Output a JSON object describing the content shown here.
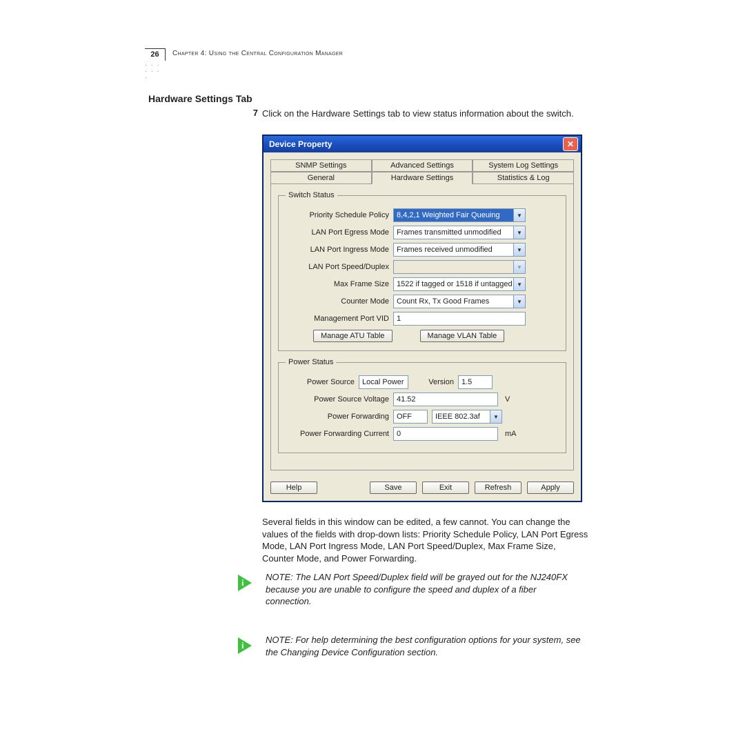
{
  "header": {
    "page_number": "26",
    "chapter_line": "Chapter 4: Using the Central Configuration Manager"
  },
  "section_title": "Hardware Settings Tab",
  "step": {
    "num": "7",
    "text": "Click on the Hardware Settings tab to view status information about the switch."
  },
  "window": {
    "title": "Device Property",
    "close": "✕",
    "tabs_row1": [
      "SNMP Settings",
      "Advanced Settings",
      "System Log Settings"
    ],
    "tabs_row2": [
      "General",
      "Hardware Settings",
      "Statistics & Log"
    ],
    "switch_status": {
      "legend": "Switch Status",
      "priority_label": "Priority Schedule Policy",
      "priority_value": "8,4,2,1 Weighted Fair Queuing",
      "egress_label": "LAN Port Egress Mode",
      "egress_value": "Frames transmitted unmodified",
      "ingress_label": "LAN Port Ingress Mode",
      "ingress_value": "Frames received unmodified",
      "speed_label": "LAN Port Speed/Duplex",
      "speed_value": "",
      "maxframe_label": "Max Frame Size",
      "maxframe_value": "1522 if tagged or 1518 if untagged",
      "counter_label": "Counter Mode",
      "counter_value": "Count Rx, Tx Good Frames",
      "mgmt_vid_label": "Management Port VID",
      "mgmt_vid_value": "1",
      "btn_atu": "Manage ATU Table",
      "btn_vlan": "Manage VLAN Table"
    },
    "power_status": {
      "legend": "Power Status",
      "source_label": "Power  Source",
      "source_value": "Local Power",
      "version_label": "Version",
      "version_value": "1.5",
      "voltage_label": "Power Source Voltage",
      "voltage_value": "41.52",
      "voltage_unit": "V",
      "forwarding_label": "Power Forwarding",
      "forwarding_value": "OFF",
      "forwarding_std": "IEEE 802.3af",
      "current_label": "Power Forwarding Current",
      "current_value": "0",
      "current_unit": "mA"
    },
    "buttons": {
      "help": "Help",
      "save": "Save",
      "exit": "Exit",
      "refresh": "Refresh",
      "apply": "Apply"
    }
  },
  "paragraph": "Several fields in this window can be edited, a few cannot. You can change the values of the fields with drop-down lists: Priority Schedule Policy, LAN Port Egress Mode, LAN Port Ingress Mode, LAN Port Speed/Duplex, Max Frame Size, Counter Mode, and Power Forwarding.",
  "note1": "NOTE: The LAN Port Speed/Duplex field will be grayed out for the NJ240FX because you are unable to configure the speed and duplex of a fiber connection.",
  "note2": "NOTE:  For help determining the best configuration options for your system, see the Changing Device Configuration section."
}
